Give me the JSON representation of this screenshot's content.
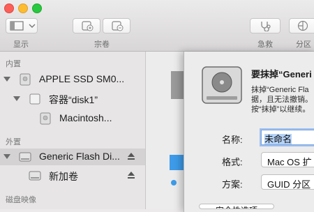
{
  "toolbar": {
    "display_label": "显示",
    "volume_label": "宗卷",
    "firstaid_label": "急救",
    "partition_label": "分区"
  },
  "sidebar": {
    "internal_header": "内置",
    "external_header": "外置",
    "images_header": "磁盘映像",
    "items": [
      {
        "label": "APPLE SSD SM0..."
      },
      {
        "label": "容器“disk1”"
      },
      {
        "label": "Macintosh..."
      },
      {
        "label": "Generic Flash Di..."
      },
      {
        "label": "新加卷"
      }
    ]
  },
  "sheet": {
    "title": "要抹掉“Generi",
    "desc_line1": "抹掉“Generic Fla",
    "desc_line2": "据，且无法撤销。",
    "desc_line3": "按“抹掉”以继续。",
    "name_label": "名称:",
    "name_value": "未命名",
    "format_label": "格式:",
    "format_value": "Mac OS 扩",
    "scheme_label": "方案:",
    "scheme_value": "GUID 分区",
    "security_button": "安全性选项"
  },
  "colors": {
    "accent_blue": "#3d9be9",
    "selection": "#d4d2d3"
  }
}
